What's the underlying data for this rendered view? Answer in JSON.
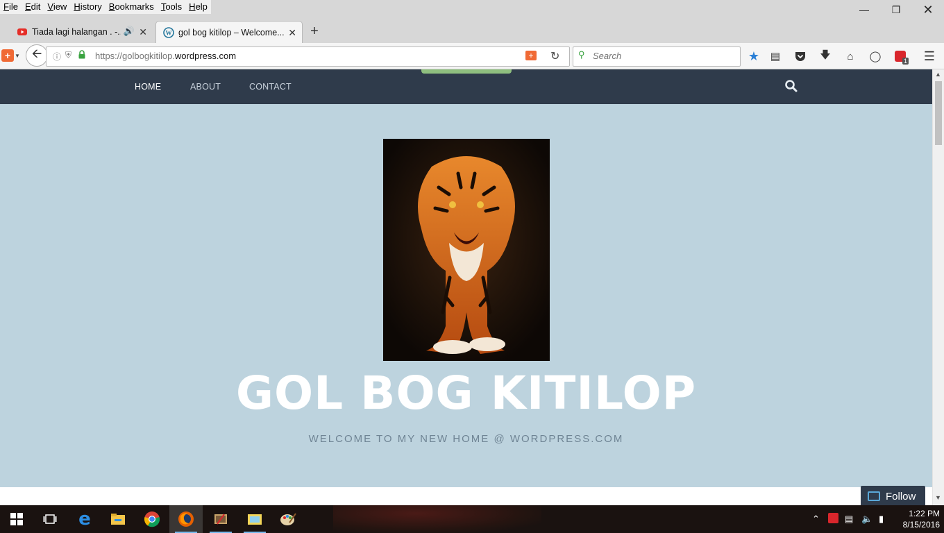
{
  "menubar": {
    "items": [
      "File",
      "Edit",
      "View",
      "History",
      "Bookmarks",
      "Tools",
      "Help"
    ]
  },
  "tabs": [
    {
      "title": "Tiada lagi halangan . -...",
      "icon": "youtube-icon",
      "audio": true
    },
    {
      "title": "gol bog kitilop – Welcome...",
      "icon": "wordpress-icon",
      "active": true
    }
  ],
  "urlbar": {
    "url_prefix": "https://golbogkitilop.",
    "url_domain": "wordpress.com"
  },
  "searchbar": {
    "placeholder": "Search"
  },
  "toolbar": {
    "badge_count": "1"
  },
  "site": {
    "nav": [
      "HOME",
      "ABOUT",
      "CONTACT"
    ],
    "title": "GOL BOG KITILOP",
    "description": "WELCOME TO MY NEW HOME @ WORDPRESS.COM",
    "follow_label": "Follow"
  },
  "taskbar": {
    "time": "1:22 PM",
    "date": "8/15/2016"
  },
  "colors": {
    "header_bg": "#2f3b4b",
    "hero_bg": "#bdd3de",
    "title_color": "#ffffff",
    "accent_green": "#8fbf7f"
  }
}
